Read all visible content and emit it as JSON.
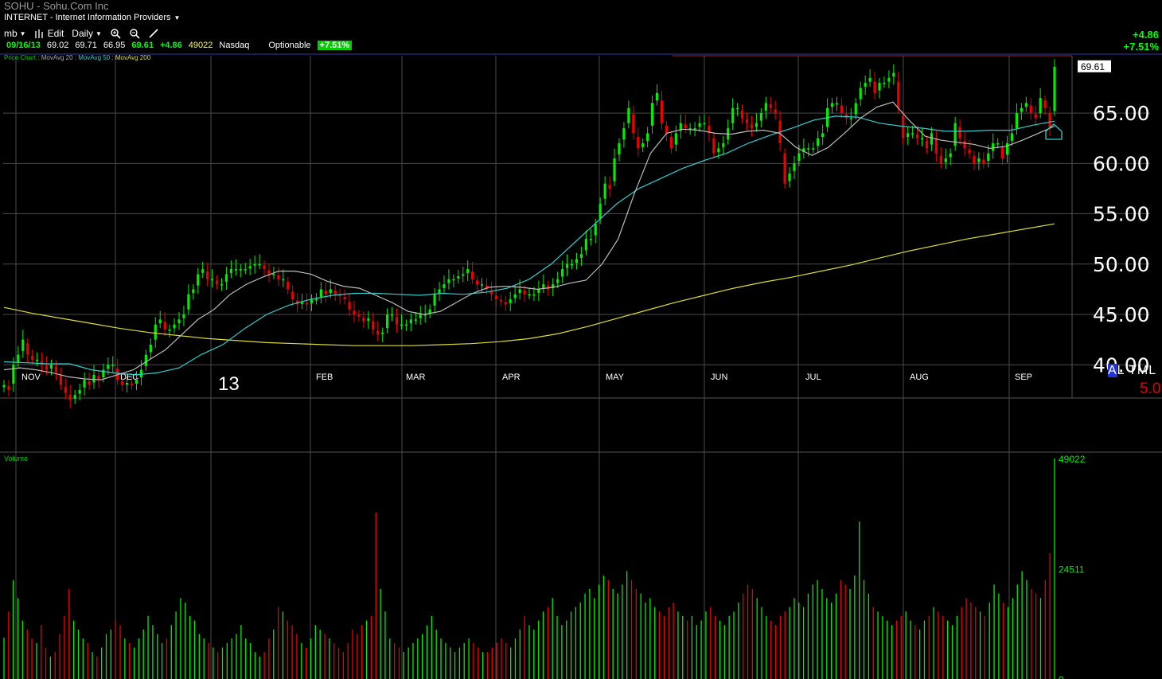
{
  "header": {
    "title": "SOHU - Sohu.Com Inc",
    "industry": "INTERNET - Internet Information Providers",
    "industry_caret": "▼"
  },
  "toolbar": {
    "layout_label": "mb",
    "edit_label": "Edit",
    "period_label": "Daily",
    "caret": "▼",
    "icons": [
      "bars-icon",
      "zoom-in-icon",
      "zoom-out-icon",
      "pencil-icon"
    ]
  },
  "quote": {
    "date": "09/16/13",
    "open": "69.02",
    "high": "69.71",
    "low": "66.95",
    "close": "69.61",
    "change": "+4.86",
    "volume": "49022",
    "exchange": "Nasdaq",
    "optionable": "Optionable",
    "pct_change": "+7.51%"
  },
  "right_change": {
    "change": "+4.86",
    "pct": "+7.51%"
  },
  "legend": {
    "price_chart": "Price Chart :",
    "ma20": "MovAvg 20 :",
    "ma50": "MovAvg 50 :",
    "ma200": "MovAvg 200"
  },
  "side_labels": {
    "alt_a": "A",
    "alt_rest": "L TML",
    "five": "5.0",
    "year": "13"
  },
  "colors": {
    "up": "#00ee00",
    "down": "#ee0000",
    "grid": "#4a4a4a",
    "ma20": "#bbbbbb",
    "ma50": "#33cccc",
    "ma200": "#dddd33",
    "last_price_box": "#ffffff"
  },
  "chart_data": [
    {
      "type": "candlestick",
      "title": "SOHU",
      "y_ticks": [
        "65.00",
        "60.00",
        "55.00",
        "50.00",
        "45.00",
        "40.00"
      ],
      "ylim": [
        36.7,
        70.7
      ],
      "x_tick_labels": [
        "NOV",
        "DEC",
        "FEB",
        "MAR",
        "APR",
        "MAY",
        "JUN",
        "JUL",
        "AUG",
        "SEP"
      ],
      "last_price": "69.61",
      "series_close": [
        38,
        37.5,
        40,
        41,
        42.5,
        41,
        40.5,
        40.5,
        40,
        39.5,
        40,
        39.3,
        38,
        37.2,
        36.5,
        37,
        37.5,
        38.5,
        38,
        39,
        38.5,
        39.5,
        40,
        40,
        38.5,
        38,
        38.2,
        38,
        38.5,
        39.5,
        41,
        42,
        44,
        44.5,
        43.5,
        43.5,
        44,
        44.5,
        45,
        47,
        47.5,
        49,
        49.5,
        48.5,
        48.5,
        48,
        48,
        49,
        49.5,
        49.5,
        49.5,
        49.5,
        49.8,
        50,
        50,
        49.5,
        49,
        49,
        48.5,
        48.5,
        47.5,
        46.5,
        46,
        46.2,
        46,
        46.5,
        46.5,
        47.5,
        47,
        47.5,
        47,
        46.8,
        46.5,
        45.5,
        45,
        44.8,
        44.3,
        44.6,
        43.5,
        43,
        43.2,
        45,
        45,
        44,
        44,
        44,
        44.5,
        44.5,
        45,
        45,
        45.5,
        47,
        47.5,
        48,
        48.5,
        48.5,
        48.8,
        49,
        49.5,
        48.5,
        48,
        48,
        47.5,
        47,
        46.5,
        46.3,
        46,
        46.5,
        47,
        47.5,
        47,
        47,
        47,
        47.5,
        48,
        47.5,
        48,
        48.5,
        49.5,
        50,
        50,
        50.5,
        51,
        52.5,
        52.5,
        54,
        56,
        58,
        57.5,
        60.5,
        62,
        63.5,
        65.5,
        63,
        61.5,
        62,
        63,
        66,
        67,
        64,
        63,
        61.5,
        63,
        64,
        63.5,
        63.5,
        63.5,
        64,
        64,
        63,
        61,
        61.5,
        62,
        63.5,
        65.5,
        65.5,
        64.5,
        64,
        63.5,
        64,
        65,
        66,
        65.5,
        65,
        62,
        58,
        59,
        60,
        61,
        61.5,
        61.5,
        61.5,
        62.5,
        63,
        65.5,
        66,
        66,
        65,
        64.5,
        64.5,
        66,
        67.5,
        68,
        68.5,
        67,
        68,
        68,
        68.5,
        69,
        65.5,
        62.5,
        63,
        63,
        62.5,
        62.5,
        61.5,
        63,
        61,
        60,
        60.5,
        61,
        64,
        62.5,
        61.5,
        61,
        60,
        60.5,
        60,
        61,
        62,
        62,
        60.5,
        62,
        63,
        65,
        65.5,
        66,
        65,
        64.5,
        66.5,
        65.5,
        63.5,
        69.61
      ],
      "ma20_values": [
        39.5,
        39.7,
        39.5,
        39.2,
        38.8,
        38.6,
        38.5,
        39,
        39.5,
        40.5,
        41.5,
        43,
        44.5,
        45.5,
        47,
        48,
        48.7,
        49.3,
        49.3,
        49,
        48.3,
        47.8,
        47.6,
        46.9,
        46.2,
        45.3,
        45,
        45.3,
        46.2,
        47.1,
        47.7,
        47.8,
        47.7,
        47.5,
        47.7,
        48.1,
        48.4,
        50,
        52.5,
        57,
        61,
        63,
        63.4,
        63.3,
        63,
        62.9,
        63.2,
        63.3,
        63,
        61.6,
        60.8,
        61.6,
        63,
        64.5,
        65.6,
        66.1,
        64.3,
        62.7,
        62.3,
        62.1,
        61.9,
        61.5,
        61.7,
        62.3,
        63,
        63.7
      ],
      "ma50_values": [
        40.3,
        40.2,
        40.1,
        40.1,
        39.5,
        39.2,
        39,
        39.2,
        39.7,
        41,
        42,
        43.6,
        45,
        45.9,
        46.5,
        46.9,
        47.1,
        47.1,
        47,
        46.9,
        47.1,
        47,
        47.2,
        47.6,
        48.5,
        50,
        52,
        54,
        56,
        57.5,
        58.5,
        59.5,
        60.3,
        61,
        62,
        62.8,
        63.5,
        64.3,
        64.7,
        64.6,
        64,
        63.7,
        63.5,
        63.2,
        63.2,
        63.3,
        63.3,
        63.8,
        64.2
      ],
      "ma200_values": [
        45.7,
        45.1,
        44.6,
        44.1,
        43.6,
        43.2,
        42.9,
        42.6,
        42.4,
        42.2,
        42.1,
        42,
        41.9,
        41.9,
        41.9,
        42,
        42.1,
        42.3,
        42.6,
        43.1,
        43.8,
        44.6,
        45.4,
        46.2,
        46.9,
        47.6,
        48.2,
        48.7,
        49.3,
        49.9,
        50.6,
        51.3,
        51.9,
        52.5,
        53,
        53.5,
        54
      ],
      "x_range_days": 250
    },
    {
      "type": "bar",
      "title": "Volume",
      "y_ticks": [
        "49022",
        "24511",
        "0"
      ],
      "ylim": [
        0,
        49022
      ],
      "last_volume": 49022,
      "volume_values": [
        9200,
        15000,
        22000,
        18000,
        13000,
        11000,
        9000,
        8000,
        12000,
        7000,
        5000,
        6000,
        10000,
        14000,
        20000,
        13000,
        11000,
        9000,
        8000,
        6000,
        5000,
        7000,
        10000,
        11000,
        13000,
        12000,
        9000,
        8000,
        7000,
        9000,
        11000,
        14000,
        12000,
        10000,
        8000,
        9000,
        12000,
        15000,
        18000,
        17000,
        14000,
        13000,
        10000,
        9000,
        8000,
        7000,
        6000,
        7000,
        8000,
        9000,
        10000,
        12000,
        9000,
        8000,
        6000,
        5000,
        6000,
        9000,
        11000,
        16000,
        15000,
        13000,
        12000,
        10000,
        8000,
        7000,
        9000,
        12000,
        11000,
        10000,
        9000,
        8000,
        7000,
        6000,
        8000,
        11000,
        10000,
        12000,
        13000,
        14000,
        37000,
        20000,
        15000,
        9000,
        8000,
        7000,
        6000,
        7000,
        8000,
        9000,
        10000,
        12000,
        14000,
        11000,
        9000,
        8000,
        7000,
        6000,
        7000,
        8000,
        9000,
        8000,
        7000,
        6000,
        6000,
        7000,
        8000,
        9000,
        8000,
        7000,
        9000,
        11000,
        14000,
        12000,
        11000,
        13000,
        15000,
        16000,
        18000,
        14000,
        12000,
        13000,
        15000,
        16000,
        17000,
        19000,
        20000,
        18000,
        21000,
        23000,
        22000,
        20000,
        19000,
        21000,
        24000,
        22000,
        20000,
        19000,
        17000,
        18000,
        16000,
        15000,
        14000,
        16000,
        17000,
        15000,
        14000,
        13000,
        14000,
        12000,
        13000,
        15000,
        16000,
        14000,
        13000,
        12000,
        14000,
        15000,
        17000,
        19000,
        21000,
        20000,
        18000,
        16000,
        14000,
        13000,
        12000,
        14000,
        15000,
        16000,
        18000,
        17000,
        16000,
        19000,
        21000,
        22000,
        20000,
        18000,
        17000,
        19000,
        22000,
        21000,
        20000,
        23000,
        35000,
        22000,
        19000,
        16000,
        15000,
        14000,
        13000,
        12000,
        13000,
        14000,
        15000,
        13000,
        12000,
        11000,
        13000,
        14000,
        16000,
        15000,
        14000,
        13000,
        12000,
        14000,
        16000,
        18000,
        17000,
        16000,
        15000,
        14000,
        17000,
        21000,
        19000,
        17000,
        16000,
        18000,
        21000,
        24000,
        22000,
        20000,
        19000,
        18000,
        22000,
        28000,
        49022
      ]
    }
  ]
}
